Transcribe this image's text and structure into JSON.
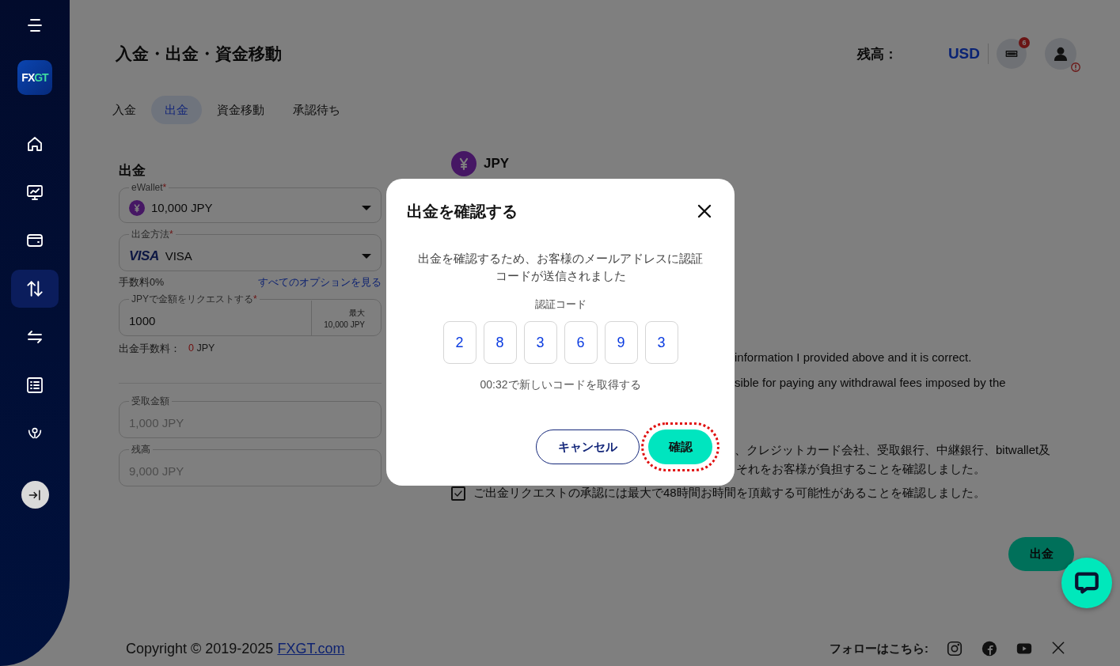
{
  "sidebar": {
    "logo": {
      "text": "FX",
      "accent": "GT"
    },
    "items": [
      {
        "selected": false
      },
      {
        "selected": false
      },
      {
        "selected": false
      },
      {
        "selected": true
      },
      {
        "selected": false
      },
      {
        "selected": false
      },
      {
        "selected": false
      }
    ]
  },
  "header": {
    "title": "入金・出金・資金移動",
    "balance_label": "残高：",
    "currency": "USD",
    "notification_count": "6"
  },
  "tabs": [
    {
      "label": "入金",
      "selected": false
    },
    {
      "label": "出金",
      "selected": true
    },
    {
      "label": "資金移動",
      "selected": false
    },
    {
      "label": "承認待ち",
      "selected": false
    }
  ],
  "form": {
    "heading": "出金",
    "wallet": {
      "label": "eWallet",
      "required_mark": "*",
      "value": "10,000 JPY"
    },
    "method": {
      "label": "出金方法",
      "required_mark": "*",
      "brand": "VISA",
      "value": "VISA"
    },
    "fee": "手数料0%",
    "options_link": "すべてのオプションを見る",
    "amount": {
      "label": "JPYで金額をリクエストする",
      "required_mark": "*",
      "value": "1000",
      "max_label": "最大",
      "max_value": "10,000 JPY"
    },
    "withdrawal_fee": {
      "label": "出金手数料：",
      "amount": "0",
      "currency": "JPY"
    },
    "received": {
      "label": "受取金額",
      "value": "1,000 JPY",
      "disabled": true
    },
    "balance": {
      "label": "残高",
      "value": "9,000 JPY",
      "disabled": true
    }
  },
  "right": {
    "currency": "JPY",
    "text_lines": [
      {
        "text": "information I provided above and it is correct.",
        "kind": "upper"
      },
      {
        "text": "sible for paying any withdrawal fees imposed by the",
        "kind": "upper"
      },
      {
        "text": "、クレジットカード会社、受取銀行、中継銀行、bitwallet及",
        "kind": "lower"
      },
      {
        "text": "それをお客様が負担することを確認しました。",
        "kind": "tight"
      }
    ],
    "checkbox": {
      "label": "ご出金リクエストの承認には最大で48時間お時間を頂戴する可能性があることを確認しました。",
      "checked": true
    },
    "submit": "出金"
  },
  "footer": {
    "copyright": "Copyright © 2019-2025",
    "link": "FXGT.com",
    "follow_label": "フォローはこちら:"
  },
  "modal": {
    "title": "出金を確認する",
    "message": "出金を確認するため、お客様のメールアドレスに認証コードが送信されました",
    "code_label": "認証コード",
    "code_digits": [
      "2",
      "8",
      "3",
      "6",
      "9",
      "3"
    ],
    "resend": "00:32で新しいコードを取得する",
    "buttons": [
      {
        "label": "キャンセル",
        "kind": "secondary",
        "highlighted": false
      },
      {
        "label": "確認",
        "kind": "primary",
        "highlighted": true
      }
    ]
  }
}
